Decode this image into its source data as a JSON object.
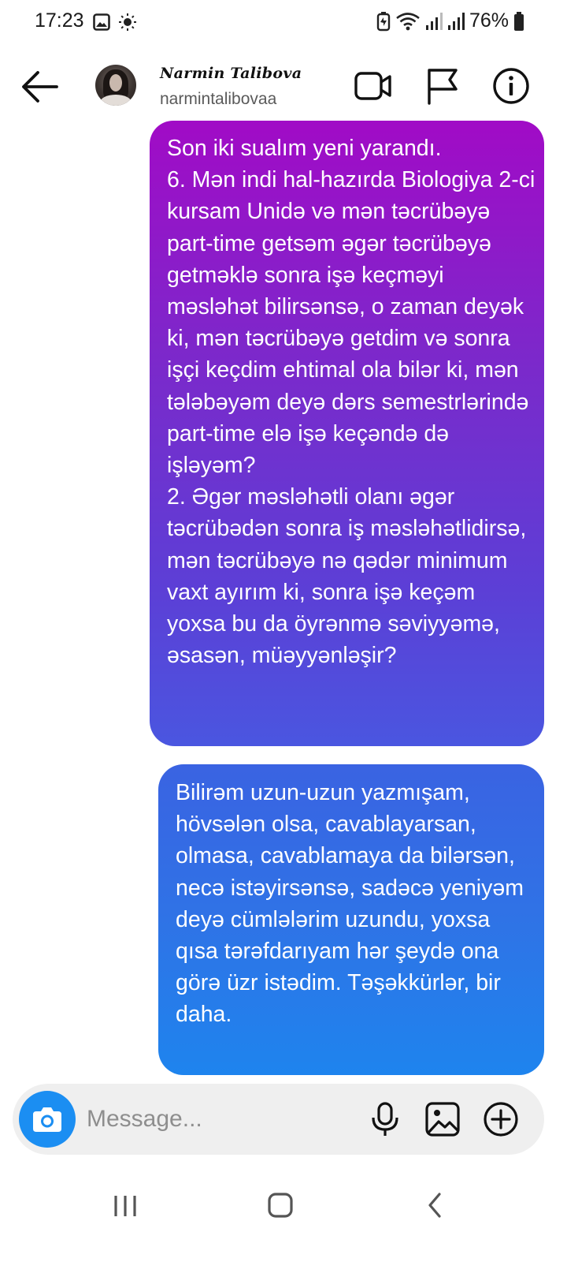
{
  "status_bar": {
    "time": "17:23",
    "battery_percent": "76%",
    "icons": [
      "image-icon",
      "sun-icon",
      "battery-saver-icon",
      "wifi-icon",
      "signal-icon",
      "signal-icon",
      "battery-icon"
    ]
  },
  "header": {
    "contact_name": "Narmin Talibova",
    "username": "narmintalibovaa",
    "icons": [
      "back-arrow-icon",
      "video-call-icon",
      "flag-icon",
      "info-icon"
    ]
  },
  "messages": [
    {
      "sender": "self",
      "text": "Son iki sualım yeni yarandı.\n6. Mən indi hal-hazırda Biologiya 2-ci kursam Unidə və mən təcrübəyə part-time getsəm əgər təcrübəyə getməklə sonra işə keçməyi məsləhət bilirsənsə, o zaman deyək ki, mən təcrübəyə getdim və sonra işçi keçdim ehtimal ola bilər ki, mən tələbəyəm deyə dərs semestrlərində part-time elə işə keçəndə də işləyəm?\n2. Əgər məsləhətli olanı əgər təcrübədən sonra iş məsləhətlidirsə, mən təcrübəyə nə qədər minimum vaxt ayırım ki, sonra işə keçəm yoxsa bu da öyrənmə səviyyəmə, əsasən, müəyyənləşir?"
    },
    {
      "sender": "self",
      "text": "Bilirəm uzun-uzun yazmışam, hövsələn olsa, cavablayarsan, olmasa, cavablamaya da bilərsən, necə istəyirsənsə, sadəcə yeniyəm deyə cümlələrim uzundu, yoxsa qısa tərəfdarıyam hər şeydə ona görə üzr istədim. Təşəkkürlər, bir daha."
    }
  ],
  "composer": {
    "placeholder": "Message...",
    "value": "",
    "icons": [
      "camera-icon",
      "microphone-icon",
      "gallery-icon",
      "add-icon"
    ]
  },
  "nav_bar": {
    "icons": [
      "recent-apps-icon",
      "home-icon",
      "back-icon"
    ]
  },
  "colors": {
    "bubble_1_top": "#a10bc6",
    "bubble_1_bottom": "#4a56e0",
    "bubble_2_top": "#3a63e2",
    "bubble_2_bottom": "#1e84ee",
    "camera_button": "#1b8ef2",
    "composer_bg": "#efefef"
  }
}
